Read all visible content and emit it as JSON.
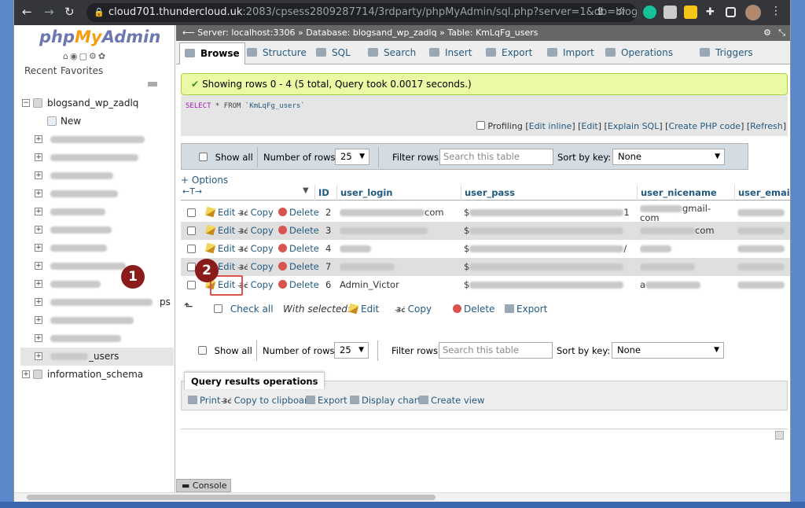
{
  "browser": {
    "url_host": "cloud701.thundercloud.uk",
    "url_path": ":2083/cpsess2809287714/3rdparty/phpMyAdmin/sql.php?server=1&db=blogsand_wp_z..."
  },
  "sidebar": {
    "logo_php": "php",
    "logo_my": "My",
    "logo_admin": "Admin",
    "recent": "Recent",
    "favorites": "Favorites",
    "db_name": "blogsand_wp_zadlq",
    "new_label": "New",
    "partial_label_ps": "ps",
    "users_table_suffix": "_users",
    "info_schema": "information_schema"
  },
  "breadcrumb": {
    "server": "Server: localhost:3306",
    "database": "Database: blogsand_wp_zadlq",
    "table": "Table: KmLqFg_users"
  },
  "tabs": [
    "Browse",
    "Structure",
    "SQL",
    "Search",
    "Insert",
    "Export",
    "Import",
    "Operations",
    "Triggers"
  ],
  "status": {
    "message": "Showing rows 0 - 4 (5 total, Query took 0.0017 seconds.)",
    "sql_select": "SELECT",
    "sql_rest": " * FROM ",
    "sql_table": "`KmLqFg_users`"
  },
  "profiling": {
    "label": "Profiling",
    "edit_inline": "Edit inline",
    "edit": "Edit",
    "explain": "Explain SQL",
    "php": "Create PHP code",
    "refresh": "Refresh"
  },
  "nav": {
    "show_all": "Show all",
    "rows_label": "Number of rows:",
    "rows_value": "25",
    "filter_label": "Filter rows:",
    "filter_placeholder": "Search this table",
    "sort_label": "Sort by key:",
    "sort_value": "None"
  },
  "options_label": "+ Options",
  "arrows_label": "←T→",
  "columns": [
    "ID",
    "user_login",
    "user_pass",
    "user_nicename",
    "user_email"
  ],
  "actions": {
    "edit": "Edit",
    "copy": "Copy",
    "delete": "Delete"
  },
  "rows": [
    {
      "id": "2",
      "login": "com",
      "pass": "$",
      "nice": "gmail-",
      "nice2": "com",
      "pass_end": "1"
    },
    {
      "id": "3",
      "login": "",
      "pass": "$",
      "nice": "com",
      "nice2": "",
      "pass_end": ""
    },
    {
      "id": "4",
      "login": "",
      "pass": "$",
      "nice": "",
      "nice2": "",
      "pass_end": "/"
    },
    {
      "id": "7",
      "login": "",
      "pass": "$",
      "nice": "",
      "nice2": "",
      "pass_end": ""
    },
    {
      "id": "6",
      "login": "Admin_Victor",
      "pass": "$",
      "nice": "a",
      "nice2": "",
      "pass_end": ""
    }
  ],
  "with_selected": {
    "check_all": "Check all",
    "label": "With selected:",
    "edit": "Edit",
    "copy": "Copy",
    "delete": "Delete",
    "export": "Export"
  },
  "qro": {
    "title": "Query results operations",
    "print": "Print",
    "clipboard": "Copy to clipboard",
    "export": "Export",
    "chart": "Display chart",
    "view": "Create view"
  },
  "console": "Console",
  "badges": {
    "one": "1",
    "two": "2"
  },
  "colors": {
    "accent_link": "#235a81",
    "success_bg": "#ebf8a4",
    "badge": "#8b1a1a"
  }
}
